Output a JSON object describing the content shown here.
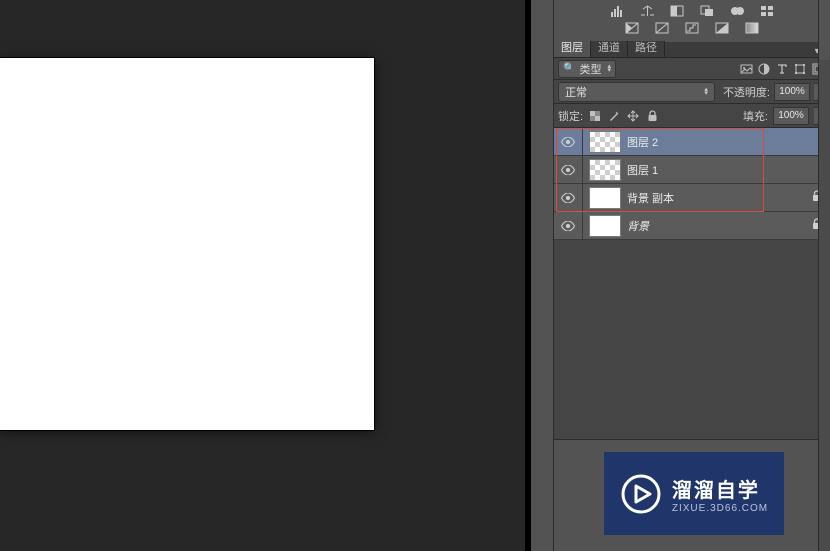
{
  "tabs": {
    "layers": "图层",
    "channels": "通道",
    "paths": "路径"
  },
  "filter": {
    "select_label": "类型"
  },
  "blend": {
    "mode": "正常",
    "opacity_label": "不透明度:",
    "opacity_value": "100%"
  },
  "lock": {
    "label": "锁定:",
    "fill_label": "填充:",
    "fill_value": "100%"
  },
  "layers_list": [
    {
      "name": "图层 2",
      "transparent": true,
      "selected": true,
      "locked": false
    },
    {
      "name": "图层 1",
      "transparent": true,
      "selected": false,
      "locked": false
    },
    {
      "name": "背景 副本",
      "transparent": false,
      "selected": false,
      "locked": true
    },
    {
      "name": "背景",
      "transparent": false,
      "selected": false,
      "locked": true,
      "italic": true
    }
  ],
  "watermark": {
    "big": "溜溜自学",
    "small": "ZIXUE.3D66.COM"
  }
}
